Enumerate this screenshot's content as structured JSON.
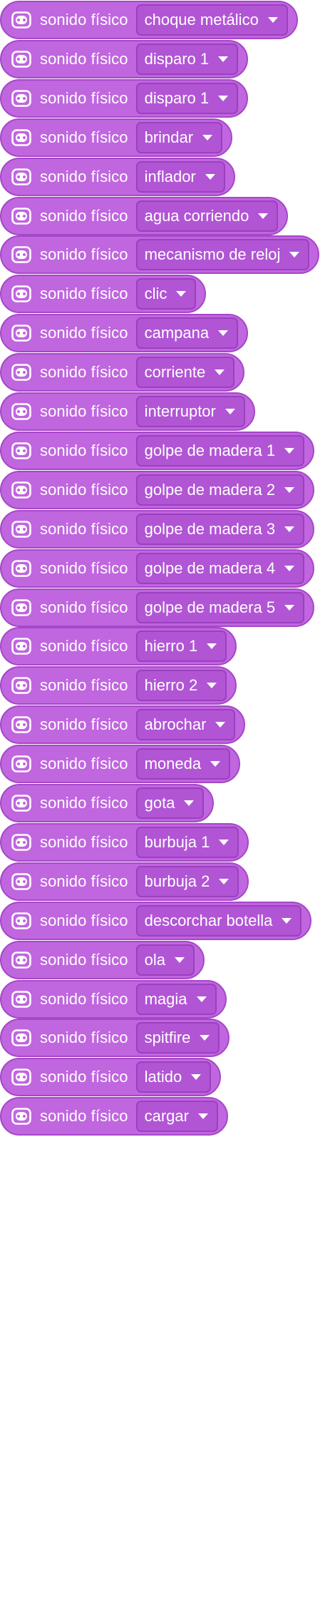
{
  "block_label": "sonido físico",
  "block_icon": "microbit-icon",
  "colors": {
    "block_fill": "#c066df",
    "block_border": "#a647c8",
    "dropdown_fill": "#b155d5",
    "text": "#ffffff"
  },
  "blocks": [
    {
      "sound": "choque metálico"
    },
    {
      "sound": "disparo 1"
    },
    {
      "sound": "disparo 1"
    },
    {
      "sound": "brindar"
    },
    {
      "sound": "inflador"
    },
    {
      "sound": "agua corriendo"
    },
    {
      "sound": "mecanismo de reloj"
    },
    {
      "sound": "clic"
    },
    {
      "sound": "campana"
    },
    {
      "sound": "corriente"
    },
    {
      "sound": "interruptor"
    },
    {
      "sound": "golpe de madera 1"
    },
    {
      "sound": "golpe de madera 2"
    },
    {
      "sound": "golpe de madera 3"
    },
    {
      "sound": "golpe de madera 4"
    },
    {
      "sound": "golpe de madera 5"
    },
    {
      "sound": "hierro 1"
    },
    {
      "sound": "hierro 2"
    },
    {
      "sound": "abrochar"
    },
    {
      "sound": "moneda"
    },
    {
      "sound": "gota"
    },
    {
      "sound": "burbuja 1"
    },
    {
      "sound": "burbuja 2"
    },
    {
      "sound": "descorchar botella"
    },
    {
      "sound": "ola"
    },
    {
      "sound": "magia"
    },
    {
      "sound": "spitfire"
    },
    {
      "sound": "latido"
    },
    {
      "sound": "cargar"
    }
  ]
}
